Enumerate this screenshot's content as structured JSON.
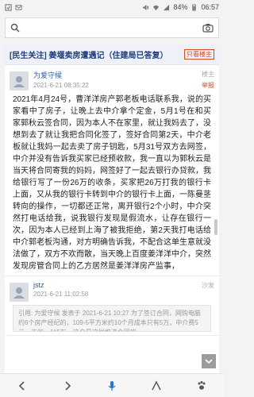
{
  "status_bar": {
    "battery": "84%",
    "time": "06:57"
  },
  "search": {
    "value": "",
    "placeholder": ""
  },
  "thread": {
    "title": "[民生关注] 姜堰卖房遭遇记（住建局已答复）",
    "only_op_label": "只看楼主"
  },
  "posts": [
    {
      "author": "为爱守候",
      "time": "2021-6-21 08:35:22",
      "floor": "楼主",
      "report": "举报",
      "body": "2021年4月24号，曹洋洋房产郭老板电话联系我，说的买家看中了房子，让晚上去中介拿个定金，5月1号在和买家郭秋云签合同，因为本人不在家里，就让我妈去了，没想到去了就让我把合同化签了，签好合同第2天，中介老板就让我妈一起去卖了房子钥匙，5月31号双方去网签，中介并没有告诉我买家已经预收款，我一直以为郭秋云是当天将合同寄我的妈妈，网签好了一起去银行办贷款，我给银行写了一份26万的收条，买家把26万打我的银行卡上面，又从我的银行卡转到中介的银行卡上面，一陈曼茎转向的操作，一切都还正常，离开银行2个小时，中介突然打电话给我，说我银行发现是假流水，让存在银行一次，因为本人已经到上海了被我拒绝，第2天我打电话给中介郭老板沟通，对方明确告诉我，不配合这单生意就没法做了，双方不欢而散，当天晚上百度姜洋洋中介，突然发现房管合同上的乙方居然是姜洋洋房产监事，"
    },
    {
      "author": "jstz",
      "time": "2021-6-21 11:02:58",
      "floor": "沙发",
      "report": "",
      "quote": "引用: 为爱守候 发表于 2021-6-21 10:27\n为了签订合同，网购电脑约6个房产经纪的，109-5平方米约10个月成本只有5万，中介费5元，正的，115万，这户是这样推进合同的..."
    }
  ],
  "icons": {
    "search": "search-icon",
    "camera": "camera-icon",
    "back": "back-arrow-icon",
    "forward": "forward-arrow-icon",
    "voice": "mic-icon",
    "tabs": "tabs-icon",
    "paw": "paw-icon"
  },
  "colors": {
    "accent": "#2a5cad",
    "title": "#1f3d80",
    "warning": "#d24a1d"
  }
}
